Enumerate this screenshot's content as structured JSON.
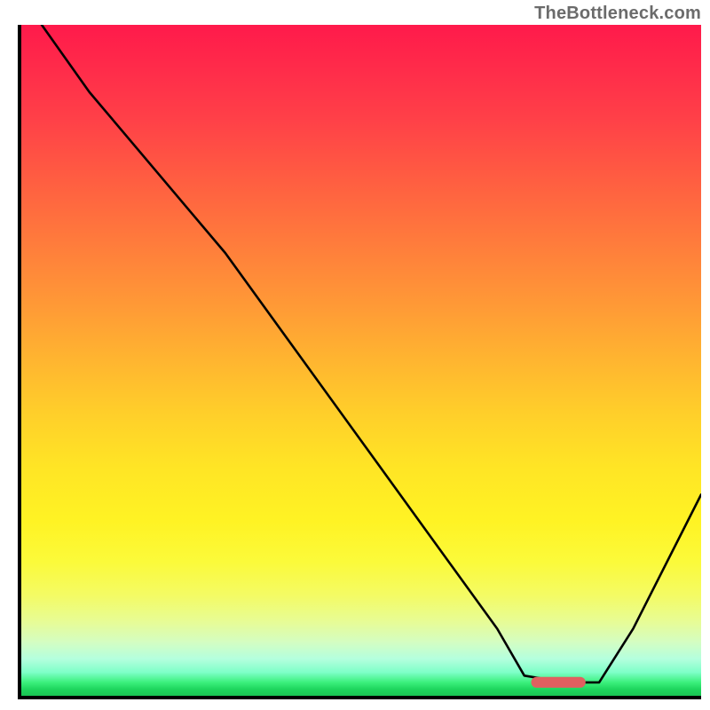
{
  "watermark": {
    "text": "TheBottleneck.com"
  },
  "chart_data": {
    "type": "line",
    "title": "",
    "xlabel": "",
    "ylabel": "",
    "x_range": [
      0,
      100
    ],
    "y_range": [
      0,
      100
    ],
    "grid": false,
    "legend": false,
    "background": {
      "kind": "vertical-gradient",
      "stops": [
        {
          "pos": 0.0,
          "color": "#ff1a4b"
        },
        {
          "pos": 0.5,
          "color": "#ffb530"
        },
        {
          "pos": 0.8,
          "color": "#fbfa3a"
        },
        {
          "pos": 0.95,
          "color": "#7effc8"
        },
        {
          "pos": 1.0,
          "color": "#19c553"
        }
      ]
    },
    "series": [
      {
        "name": "bottleneck-curve",
        "color": "#000000",
        "x": [
          3,
          10,
          20,
          25,
          30,
          40,
          50,
          60,
          70,
          74,
          80,
          85,
          90,
          100
        ],
        "y": [
          100,
          90,
          78,
          72,
          66,
          52,
          38,
          24,
          10,
          3,
          2,
          2,
          10,
          30
        ]
      }
    ],
    "marker": {
      "name": "optimal-range",
      "shape": "rounded-bar",
      "color": "#e06060",
      "x_start": 75,
      "x_end": 83,
      "y": 2,
      "height": 1.6
    }
  }
}
